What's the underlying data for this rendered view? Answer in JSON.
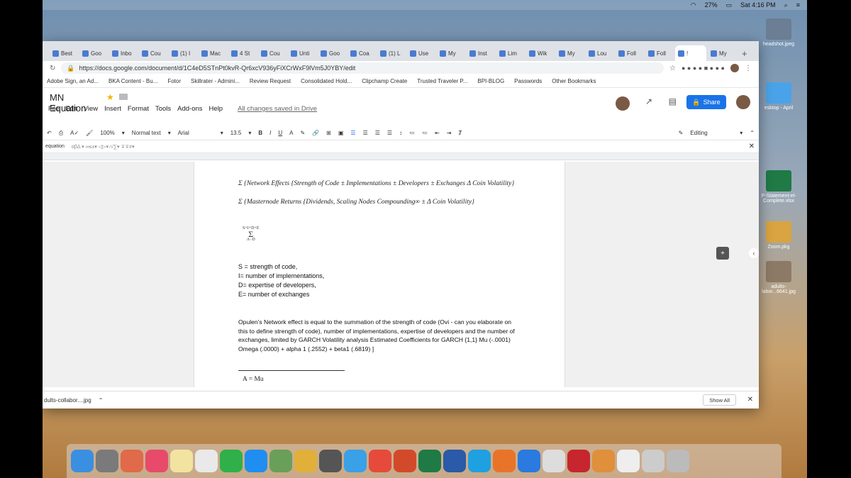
{
  "menubar": {
    "battery": "27%",
    "clock": "Sat 4:16 PM"
  },
  "desktop": {
    "icons": [
      {
        "label": "headshot.jpeg"
      },
      {
        "label": "esktop - April"
      },
      {
        "label": "P-Statement-el-Complete.xlsx"
      },
      {
        "label": "Zoom.pkg"
      },
      {
        "label": "adults-labor...6641.jpg"
      }
    ]
  },
  "browser": {
    "tabs": [
      "Best",
      "Goo",
      "Inbo",
      "Cou",
      "(1) I",
      "Mac",
      "4 St",
      "Cou",
      "Unti",
      "Goo",
      "Coa",
      "(1) L",
      "Use",
      "My",
      "Inst",
      "Lim",
      "Wik",
      "My",
      "Lou",
      "Foll",
      "Foll",
      "!",
      "My"
    ],
    "url": "https://docs.google.com/document/d/1C4eD5STnPt0kvR-Qr6xcV936yFiXCrWxF9lVm5J0YBY/edit",
    "bookmarks": [
      "Adobe Sign, an Ad...",
      "BKA Content - Bu...",
      "Fotor",
      "Skillrater - Admini...",
      "Review Request",
      "Consolidated Hold...",
      "Clipchamp Create",
      "Trusted Traveler P...",
      "BPI-BLOG",
      "Passwords",
      "Other Bookmarks"
    ]
  },
  "doc": {
    "title": "MN Equation",
    "menus": [
      "File",
      "Edit",
      "View",
      "Insert",
      "Format",
      "Tools",
      "Add-ons",
      "Help"
    ],
    "saved_status": "All changes saved in Drive",
    "share_label": "Share",
    "toolbar": {
      "zoom": "100%",
      "style": "Normal text",
      "font": "Arial",
      "size": "13.5",
      "mode": "Editing"
    },
    "find_label": "equation",
    "content": {
      "eq1": "Σ {Network Effects {Strength of Code ± Implementations ± Developers ± Exchanges Δ Coin Volatility}",
      "eq2": "Σ {Masternode Returns {Dividends, Scaling Nodes Compounding∞ ± Δ Coin Volatility}",
      "sigma_top": "S+I+D+E",
      "sigma_bottom": "A−D",
      "vars": [
        "S = strength of code,",
        "I= number of implementations,",
        "D= expertise of developers,",
        "E= number of exchanges"
      ],
      "paragraph": "Opulen's Network effect is equal to the  summation of the strength of code (Ovi - can you elaborate on this to define strength of code), number of implementations, expertise of developers and the number of exchanges, limited by GARCH Volatility analysis Estimated Coefficients for GARCH {1,1} Mu (-.0001) Omega (.0000) + alpha 1 (.2552) + beta1 (.6819) ]",
      "footnote": "A = Mu"
    }
  },
  "downloads": {
    "file": "dults-collabor....jpg",
    "show_all": "Show All"
  }
}
